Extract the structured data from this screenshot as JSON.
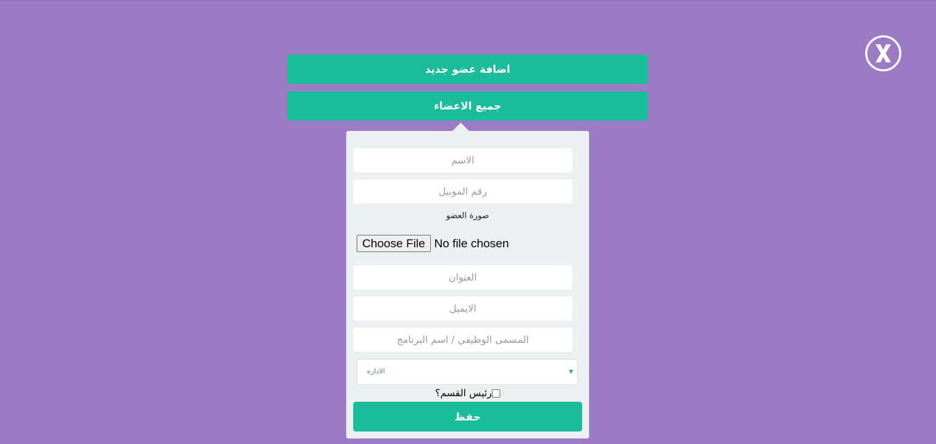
{
  "header": {
    "add_member_label": "اضافة عضو جديد",
    "all_members_label": "جميع الاعضاء"
  },
  "close_icon": "close-x-icon",
  "form": {
    "name_placeholder": "الاسم",
    "mobile_placeholder": "رقم الموبيل",
    "photo_label": "صورة العضو",
    "file_button_label": "Choose File",
    "file_status": "No file chosen",
    "address_placeholder": "العنوان",
    "email_placeholder": "الايميل",
    "job_title_placeholder": "المسمى الوظيفي / اسم البرنامج",
    "department_select_value": "الاداره",
    "department_head_label": "رئيس القسم؟",
    "save_label": "حفظ"
  },
  "colors": {
    "background": "#9b7bc3",
    "accent": "#1abc9c",
    "panel": "#ecf0f1"
  }
}
